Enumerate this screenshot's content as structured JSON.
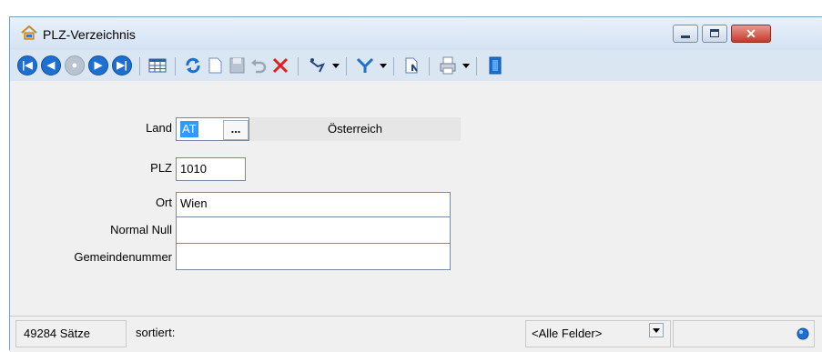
{
  "window": {
    "title": "PLZ-Verzeichnis",
    "buttons": {
      "minimize": "minimize",
      "maximize": "maximize",
      "close": "✕"
    }
  },
  "toolbar": {
    "icons": [
      "first-record-icon",
      "previous-record-icon",
      "refresh-record-icon",
      "next-record-icon",
      "last-record-icon",
      "table-view-icon",
      "reload-icon",
      "new-record-icon",
      "save-icon",
      "undo-icon",
      "delete-icon",
      "search-icon",
      "filter-icon",
      "document-icon",
      "print-icon",
      "exit-icon"
    ],
    "nav_labels": {
      "first": "|◀",
      "prev": "◀",
      "mid": "●",
      "next": "▶",
      "last": "▶|"
    }
  },
  "form": {
    "land": {
      "label": "Land",
      "value": "AT",
      "button": "...",
      "name": "Österreich"
    },
    "plz": {
      "label": "PLZ",
      "value": "1010"
    },
    "ort": {
      "label": "Ort",
      "value": "Wien"
    },
    "normal_null": {
      "label": "Normal Null",
      "value": ""
    },
    "gemeindenummer": {
      "label": "Gemeindenummer",
      "value": ""
    }
  },
  "statusbar": {
    "count": "49284 Sätze",
    "sort": "sortiert:",
    "field_select": "<Alle Felder>",
    "search": ""
  },
  "colors": {
    "accent": "#1f6fd1",
    "close": "#c6392a",
    "selection": "#3399ff",
    "delete": "#e02020"
  }
}
